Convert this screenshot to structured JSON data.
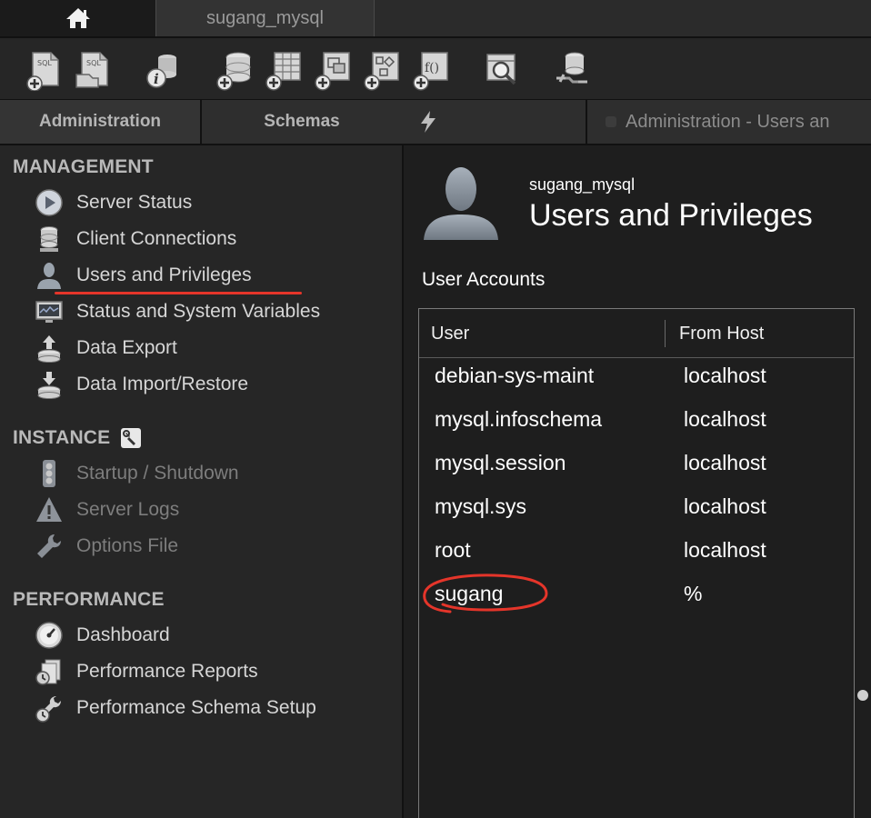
{
  "top_tabs": {
    "home": "home-icon",
    "connection": "sugang_mysql"
  },
  "toolbar": {
    "buttons": [
      "new-sql-tab-icon",
      "open-sql-script-icon",
      "inspector-icon",
      "create-schema-icon",
      "create-table-icon",
      "create-view-icon",
      "create-procedure-icon",
      "create-function-icon",
      "search-table-data-icon",
      "reconnect-icon"
    ]
  },
  "side_tabs": {
    "administration": "Administration",
    "schemas": "Schemas"
  },
  "sidebar": {
    "management": {
      "title": "MANAGEMENT",
      "items": [
        "Server Status",
        "Client Connections",
        "Users and Privileges",
        "Status and System Variables",
        "Data Export",
        "Data Import/Restore"
      ]
    },
    "instance": {
      "title": "INSTANCE",
      "items": [
        "Startup / Shutdown",
        "Server Logs",
        "Options File"
      ]
    },
    "performance": {
      "title": "PERFORMANCE",
      "items": [
        "Dashboard",
        "Performance Reports",
        "Performance Schema Setup"
      ]
    }
  },
  "main_tabs": {
    "admin_tab": "Administration - Users an"
  },
  "main": {
    "connection_name": "sugang_mysql",
    "title": "Users and Privileges",
    "accounts_label": "User Accounts",
    "columns": {
      "user": "User",
      "host": "From Host"
    },
    "rows": [
      {
        "user": "debian-sys-maint",
        "host": "localhost"
      },
      {
        "user": "mysql.infoschema",
        "host": "localhost"
      },
      {
        "user": "mysql.session",
        "host": "localhost"
      },
      {
        "user": "mysql.sys",
        "host": "localhost"
      },
      {
        "user": "root",
        "host": "localhost"
      },
      {
        "user": "sugang",
        "host": "%"
      }
    ]
  },
  "colors": {
    "annotation": "#e5352a",
    "background": "#1e1e1e",
    "sidebar": "#262626"
  }
}
